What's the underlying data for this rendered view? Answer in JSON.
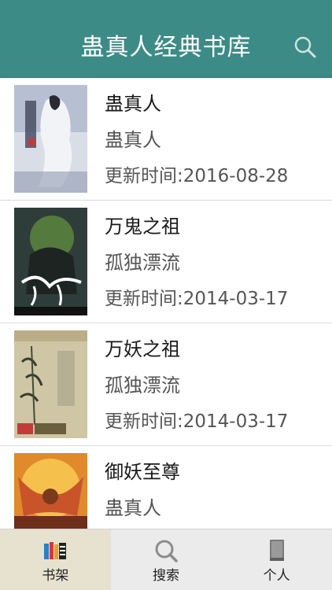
{
  "header": {
    "title": "蛊真人经典书库",
    "search_icon": "search-icon"
  },
  "books": [
    {
      "title": "蛊真人",
      "author": "蛊真人",
      "updated": "更新时间:2016-08-28"
    },
    {
      "title": "万鬼之祖",
      "author": "孤独漂流",
      "updated": "更新时间:2014-03-17"
    },
    {
      "title": "万妖之祖",
      "author": "孤独漂流",
      "updated": "更新时间:2014-03-17"
    },
    {
      "title": "御妖至尊",
      "author": "蛊真人",
      "updated": ""
    }
  ],
  "tabs": [
    {
      "label": "书架",
      "icon": "bookshelf-icon",
      "active": true
    },
    {
      "label": "搜索",
      "icon": "search-icon",
      "active": false
    },
    {
      "label": "个人",
      "icon": "book-icon",
      "active": false
    }
  ],
  "colors": {
    "header_bg": "#3d8b86",
    "active_tab_bg": "#e7e2cf"
  }
}
